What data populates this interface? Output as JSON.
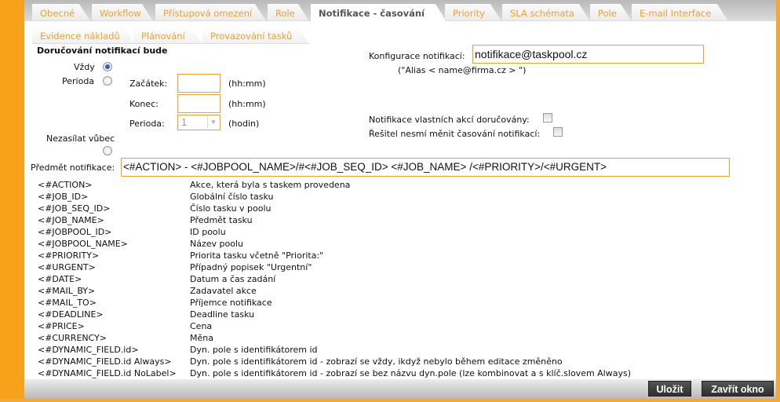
{
  "tabs_row1": [
    {
      "label": "Obecné"
    },
    {
      "label": "Workflow"
    },
    {
      "label": "Přístupová omezení"
    },
    {
      "label": "Role"
    },
    {
      "label": "Notifikace - časování",
      "active": true
    },
    {
      "label": "Priority"
    },
    {
      "label": "SLA schémata"
    },
    {
      "label": "Pole"
    },
    {
      "label": "E-mail Interface"
    }
  ],
  "tabs_row2": [
    {
      "label": "Evidence nákladů"
    },
    {
      "label": "Plánování"
    },
    {
      "label": "Provazování tasků"
    }
  ],
  "form": {
    "section_title": "Doručování notifikací bude",
    "always_label": "Vždy",
    "always_selected": true,
    "period_label": "Perioda",
    "period_selected": false,
    "start_label": "Začátek:",
    "start_value": "",
    "start_unit": "(hh:mm)",
    "end_label": "Konec:",
    "end_value": "",
    "end_unit": "(hh:mm)",
    "period_select_label": "Perioda:",
    "period_select_value": "1",
    "period_unit": "(hodin)",
    "never_label": "Nezasílat vůbec",
    "never_selected": false,
    "config_label": "Konfigurace notifikací:",
    "config_value": "notifikace@taskpool.cz",
    "config_hint": "(\"Alias  < name@firma.cz > \")",
    "own_actions_label": "Notifikace vlastních akcí doručovány:",
    "own_actions_checked": false,
    "solver_label": "Řešitel nesmí měnit časování notifikací:",
    "solver_checked": false,
    "subject_label": "Předmět notifikace:",
    "subject_value": "<#ACTION> - <#JOBPOOL_NAME>/#<#JOB_SEQ_ID> <#JOB_NAME> /<#PRIORITY>/<#URGENT>"
  },
  "placeholders": [
    {
      "tag": "<#ACTION>",
      "desc": "Akce, která byla s taskem provedena"
    },
    {
      "tag": "<#JOB_ID>",
      "desc": "Globální číslo tasku"
    },
    {
      "tag": "<#JOB_SEQ_ID>",
      "desc": "Číslo tasku v poolu"
    },
    {
      "tag": "<#JOB_NAME>",
      "desc": "Předmět tasku"
    },
    {
      "tag": "<#JOBPOOL_ID>",
      "desc": "ID poolu"
    },
    {
      "tag": "<#JOBPOOL_NAME>",
      "desc": "Název poolu"
    },
    {
      "tag": "<#PRIORITY>",
      "desc": "Priorita tasku včetně \"Priorita:\""
    },
    {
      "tag": "<#URGENT>",
      "desc": "Případný popisek \"Urgentní\""
    },
    {
      "tag": "<#DATE>",
      "desc": "Datum a čas zadání"
    },
    {
      "tag": "<#MAIL_BY>",
      "desc": "Zadavatel akce"
    },
    {
      "tag": "<#MAIL_TO>",
      "desc": "Příjemce notifikace"
    },
    {
      "tag": "<#DEADLINE>",
      "desc": "Deadline tasku"
    },
    {
      "tag": "<#PRICE>",
      "desc": "Cena"
    },
    {
      "tag": "<#CURRENCY>",
      "desc": "Měna"
    },
    {
      "tag": "<#DYNAMIC_FIELD.id>",
      "desc": "Dyn. pole s identifikátorem id"
    },
    {
      "tag": "<#DYNAMIC_FIELD.id Always>",
      "desc": "Dyn. pole s identifikátorem id - zobrazí se vždy, ikdyž nebylo během editace změněno"
    },
    {
      "tag": "<#DYNAMIC_FIELD.id NoLabel>",
      "desc": "Dyn. pole s identifikátorem id - zobrazí se bez názvu dyn.pole (lze kombinovat a s klíč.slovem Always)"
    }
  ],
  "footer": {
    "save_label": "Uložit",
    "close_label": "Zavřít okno"
  },
  "colors": {
    "accent": "#f7a21b",
    "tab_text": "#f0a030",
    "button": "#3a3a3a"
  }
}
